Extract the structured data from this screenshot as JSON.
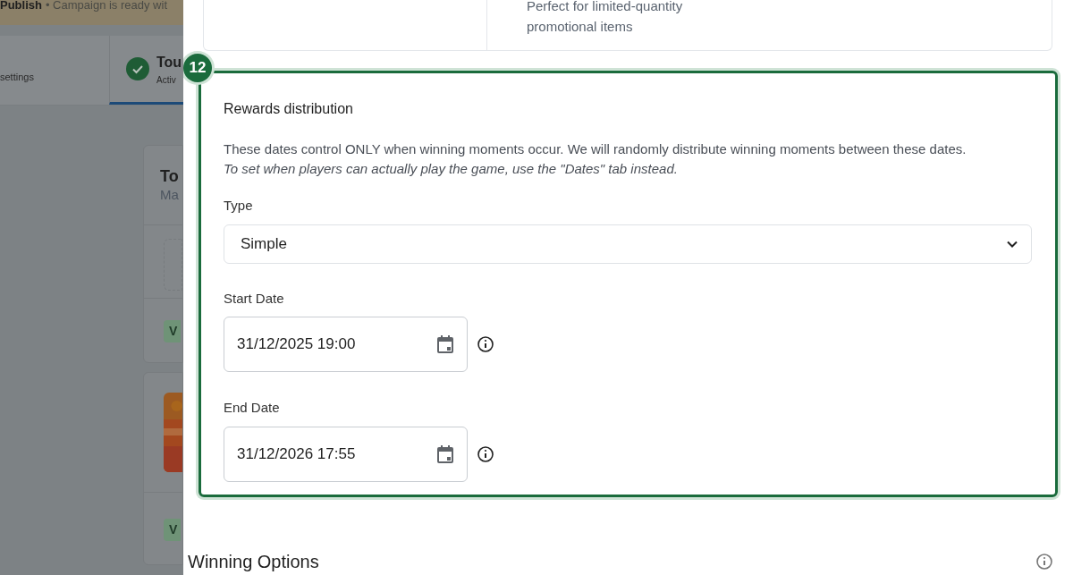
{
  "background": {
    "banner": {
      "title": "Publish",
      "message": "• Campaign is ready wit"
    },
    "tabs": [
      {
        "label": "settings",
        "selected": false,
        "complete": false
      },
      {
        "label": "Tou",
        "subtitle": "Activ",
        "selected": true,
        "complete": true
      }
    ],
    "cards": [
      {
        "kind": "text",
        "title": "To",
        "subtitle": "Ma",
        "badge": "V"
      },
      {
        "kind": "picture",
        "badge": "V"
      }
    ]
  },
  "drawer": {
    "option_card": {
      "description": "Perfect for limited-quantity promotional items"
    },
    "step": "12",
    "section": {
      "title": "Rewards distribution",
      "description": "These dates control ONLY when winning moments occur. We will randomly distribute winning moments between these dates.",
      "note": "To set when players can actually play the game, use the \"Dates\" tab instead.",
      "type": {
        "label": "Type",
        "value": "Simple"
      },
      "dates": [
        {
          "label": "Start Date",
          "value": "31/12/2025 19:00"
        },
        {
          "label": "End Date",
          "value": "31/12/2026 17:55"
        }
      ]
    },
    "next_section": {
      "title": "Winning Options"
    }
  }
}
